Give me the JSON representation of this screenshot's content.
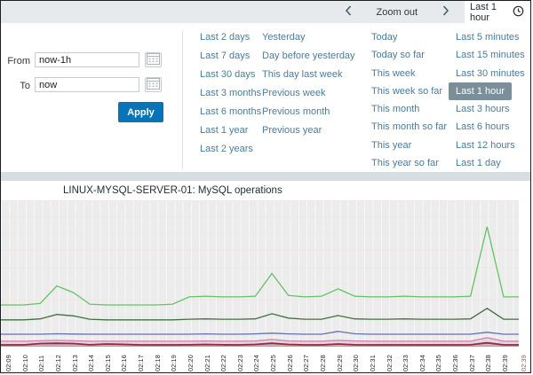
{
  "toolbar": {
    "zoom_out_label": "Zoom out",
    "time_tab_label": "Last 1 hour"
  },
  "filter": {
    "from_label": "From",
    "from_value": "now-1h",
    "to_label": "To",
    "to_value": "now",
    "apply_label": "Apply"
  },
  "quick_ranges": {
    "selected": "Last 1 hour",
    "selected_bg": "#7a8f9a",
    "link_color": "#4a7c9e",
    "columns": [
      [
        "Last 2 days",
        "Last 7 days",
        "Last 30 days",
        "Last 3 months",
        "Last 6 months",
        "Last 1 year",
        "Last 2 years"
      ],
      [
        "Yesterday",
        "Day before yesterday",
        "This day last week",
        "Previous week",
        "Previous month",
        "Previous year"
      ],
      [
        "Today",
        "Today so far",
        "This week",
        "This week so far",
        "This month",
        "This month so far",
        "This year",
        "This year so far"
      ],
      [
        "Last 5 minutes",
        "Last 15 minutes",
        "Last 30 minutes",
        "Last 1 hour",
        "Last 3 hours",
        "Last 6 hours",
        "Last 12 hours",
        "Last 1 day"
      ]
    ]
  },
  "chart_data": {
    "type": "line",
    "title": "LINUX-MYSQL-SERVER-01: MySQL operations",
    "xlabel": "",
    "ylabel": "",
    "ylim": [
      0,
      100
    ],
    "y_axis_labels_visible": false,
    "grid": true,
    "legend_position": "none",
    "x_labels": [
      "02:09",
      "02:10",
      "02:11",
      "02:12",
      "02:13",
      "02:14",
      "02:15",
      "02:16",
      "02:17",
      "02:18",
      "02:19",
      "02:20",
      "02:21",
      "02:22",
      "02:23",
      "02:24",
      "02:25",
      "02:26",
      "02:27",
      "02:28",
      "02:29",
      "02:30",
      "02:31",
      "02:32",
      "02:33",
      "02:34",
      "02:35",
      "02:36",
      "02:37",
      "02:38",
      "02:39"
    ],
    "current_time_label": "02:39",
    "current_time_color": "#c05050",
    "series": [
      {
        "name": "light-green-line",
        "color": "#62c462",
        "width": 1.3,
        "fill": false,
        "values": [
          28.5,
          28.5,
          29.5,
          41.5,
          37,
          29,
          28.5,
          28.5,
          28.5,
          28.5,
          29,
          34,
          34.5,
          34,
          34,
          34.5,
          50,
          35,
          34,
          34.5,
          39.5,
          34.5,
          34,
          34,
          34.5,
          34,
          34,
          34,
          34.5,
          82,
          34
        ]
      },
      {
        "name": "dark-green-line",
        "color": "#3f7040",
        "width": 1.3,
        "fill": false,
        "values": [
          18.3,
          18.3,
          19,
          22,
          21,
          18.7,
          18.3,
          18.3,
          18.3,
          18.3,
          18.3,
          18.7,
          19,
          18.7,
          18.7,
          19,
          22.5,
          19.5,
          18.7,
          18.7,
          21.3,
          19,
          18.7,
          18.7,
          19,
          18.7,
          18.7,
          18.7,
          19,
          26.2,
          18.7
        ]
      },
      {
        "name": "blue-line",
        "color": "#6071b5",
        "width": 1.3,
        "fill": false,
        "values": [
          8.5,
          8.5,
          8.5,
          8.8,
          8.6,
          8.5,
          8.5,
          8.5,
          8.5,
          8.5,
          8.5,
          8.5,
          8.7,
          8.5,
          8.5,
          8.7,
          9.2,
          8.7,
          8.5,
          8.5,
          10.4,
          8.8,
          8.5,
          8.5,
          8.5,
          8.5,
          8.5,
          8.5,
          8.5,
          9.8,
          8.5
        ]
      },
      {
        "name": "pink-line",
        "color": "#cf7fb0",
        "width": 1.3,
        "fill": true,
        "values": [
          3.7,
          3.7,
          4,
          4.3,
          4,
          3.7,
          3.7,
          3.7,
          3.7,
          3.7,
          3.7,
          3.7,
          3.9,
          3.7,
          3.7,
          3.9,
          4.9,
          3.9,
          3.7,
          3.7,
          4.3,
          3.9,
          3.7,
          3.7,
          3.7,
          3.7,
          3.7,
          3.7,
          3.7,
          6.1,
          3.7
        ]
      },
      {
        "name": "dark-red-line",
        "color": "#8c2f39",
        "width": 1.8,
        "fill": true,
        "values": [
          1.2,
          1.2,
          2.1,
          2.3,
          2.1,
          1.3,
          1.8,
          1.6,
          1.2,
          1.2,
          1.2,
          1.3,
          1.5,
          1.3,
          1.2,
          1.5,
          2.3,
          1.5,
          1.2,
          1.2,
          1.8,
          1.3,
          1.2,
          1.2,
          1.2,
          1.2,
          1.2,
          1.2,
          1.3,
          2.6,
          1.2
        ]
      }
    ]
  }
}
